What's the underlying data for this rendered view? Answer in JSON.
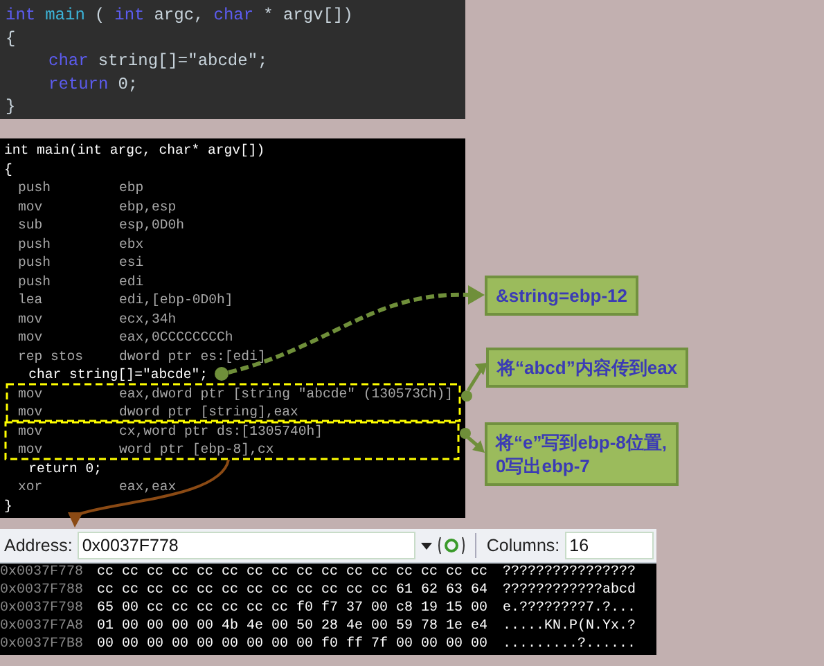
{
  "source_code": {
    "lines": [
      [
        {
          "kind": "keyword",
          "text": "int"
        },
        {
          "kind": "function",
          "text": "main"
        },
        {
          "kind": "plain",
          "text": "("
        },
        {
          "kind": "keyword",
          "text": "int"
        },
        {
          "kind": "plain",
          "text": "argc,"
        },
        {
          "kind": "keyword",
          "text": "char"
        },
        {
          "kind": "plain",
          "text": "* argv[])"
        }
      ],
      [
        {
          "kind": "plain",
          "text": "{"
        }
      ],
      [
        {
          "kind": "indent"
        },
        {
          "kind": "keyword",
          "text": "char"
        },
        {
          "kind": "plain",
          "text": "string[]=\"abcde\";"
        }
      ],
      [
        {
          "kind": "indent"
        },
        {
          "kind": "keyword",
          "text": "return"
        },
        {
          "kind": "plain",
          "text": "0;"
        }
      ],
      [
        {
          "kind": "plain",
          "text": "}"
        }
      ]
    ]
  },
  "disassembly": {
    "lines": [
      {
        "kind": "source",
        "text": "int main(int argc, char* argv[])"
      },
      {
        "kind": "source",
        "text": "{"
      },
      {
        "kind": "asm",
        "mnemonic": "push",
        "operands": "ebp"
      },
      {
        "kind": "asm",
        "mnemonic": "mov",
        "operands": "ebp,esp"
      },
      {
        "kind": "asm",
        "mnemonic": "sub",
        "operands": "esp,0D0h"
      },
      {
        "kind": "asm",
        "mnemonic": "push",
        "operands": "ebx"
      },
      {
        "kind": "asm",
        "mnemonic": "push",
        "operands": "esi"
      },
      {
        "kind": "asm",
        "mnemonic": "push",
        "operands": "edi"
      },
      {
        "kind": "asm",
        "mnemonic": "lea",
        "operands": "edi,[ebp-0D0h]"
      },
      {
        "kind": "asm",
        "mnemonic": "mov",
        "operands": "ecx,34h"
      },
      {
        "kind": "asm",
        "mnemonic": "mov",
        "operands": "eax,0CCCCCCCCh"
      },
      {
        "kind": "asm",
        "mnemonic": "rep stos",
        "operands": "dword ptr es:[edi]"
      },
      {
        "kind": "source",
        "text": "   char string[]=\"abcde\";"
      },
      {
        "kind": "asm",
        "mnemonic": "mov",
        "operands": "eax,dword ptr [string \"abcde\" (130573Ch)]"
      },
      {
        "kind": "asm",
        "mnemonic": "mov",
        "operands": "dword ptr [string],eax"
      },
      {
        "kind": "asm",
        "mnemonic": "mov",
        "operands": "cx,word ptr ds:[1305740h]"
      },
      {
        "kind": "asm",
        "mnemonic": "mov",
        "operands": "word ptr [ebp-8],cx"
      },
      {
        "kind": "source",
        "text": "   return 0;"
      },
      {
        "kind": "asm",
        "mnemonic": "xor",
        "operands": "eax,eax"
      },
      {
        "kind": "source",
        "text": "}"
      }
    ]
  },
  "callouts": [
    {
      "text": "&string=ebp-12"
    },
    {
      "text": "将“abcd”内容传到eax"
    },
    {
      "text": "将“e”写到ebp-8位置,\n0写出ebp-7"
    }
  ],
  "memory": {
    "address_label": "Address:",
    "address": "0x0037F778",
    "columns_label": "Columns:",
    "columns": "16",
    "rows": [
      {
        "address": "0x0037F778",
        "bytes": "cc cc cc cc cc cc cc cc cc cc cc cc cc cc cc cc",
        "ascii": "????????????????"
      },
      {
        "address": "0x0037F788",
        "bytes": "cc cc cc cc cc cc cc cc cc cc cc cc 61 62 63 64",
        "ascii": "????????????abcd"
      },
      {
        "address": "0x0037F798",
        "bytes": "65 00 cc cc cc cc cc cc f0 f7 37 00 c8 19 15 00",
        "ascii": "e.????????7.?..."
      },
      {
        "address": "0x0037F7A8",
        "bytes": "01 00 00 00 00 4b 4e 00 50 28 4e 00 59 78 1e e4",
        "ascii": ".....KN.P(N.Yx.?"
      },
      {
        "address": "0x0037F7B8",
        "bytes": "00 00 00 00 00 00 00 00 00 f0 ff 7f 00 00 00 00",
        "ascii": ".........?......"
      }
    ]
  }
}
